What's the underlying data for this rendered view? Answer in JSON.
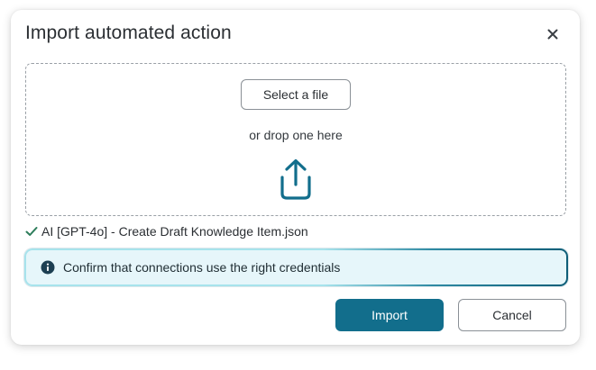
{
  "dialog": {
    "title": "Import automated action",
    "close_icon": "close-icon"
  },
  "drop_zone": {
    "select_file_label": "Select a file",
    "drop_text": "or drop one here",
    "upload_icon": "upload-icon"
  },
  "selected_file": {
    "status_icon": "check-icon",
    "name": "AI [GPT-4o] - Create Draft Knowledge Item.json"
  },
  "info_banner": {
    "icon": "info-icon",
    "text": "Confirm that connections use the right credentials"
  },
  "actions": {
    "import_label": "Import",
    "cancel_label": "Cancel"
  },
  "colors": {
    "primary": "#126e8c",
    "success_check": "#2e7d5b",
    "info_bg": "#e6f6fa",
    "info_icon": "#1c3f52"
  }
}
